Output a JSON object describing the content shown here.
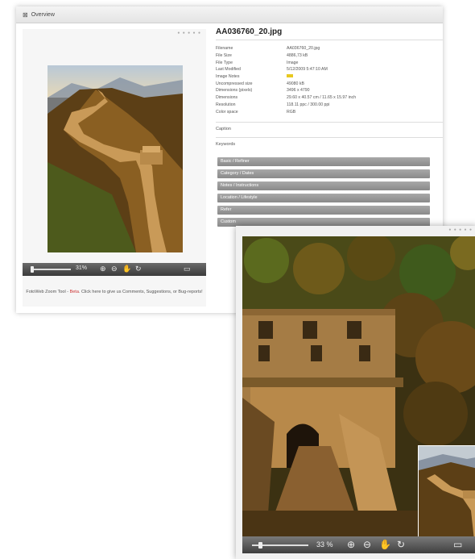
{
  "window": {
    "title": "Overview"
  },
  "viewer": {
    "zoom_level": "31%",
    "feedback_prefix": "FotoWeb Zoom Tool - ",
    "feedback_beta": "Beta",
    "feedback_suffix": ". Click here to give us Comments, Suggestions, or Bug-reports!"
  },
  "file": {
    "name": "AA036760_20.jpg",
    "meta": [
      {
        "key": "Filename",
        "value": "AA036760_20.jpg"
      },
      {
        "key": "File Size",
        "value": "4886,73 kB"
      },
      {
        "key": "File Type",
        "value": "Image"
      },
      {
        "key": "Last Modified",
        "value": "5/12/2009 5:47:10 AM"
      },
      {
        "key": "Image Notes",
        "value": ""
      },
      {
        "key": "Uncompressed size",
        "value": "49080 kB"
      },
      {
        "key": "Dimensions (pixels)",
        "value": "3496 x 4790"
      },
      {
        "key": "Dimensions",
        "value": "29.60 x 40.57 cm / 11.65 x 15.97 inch"
      },
      {
        "key": "Resolution",
        "value": "118.11 ppc / 300.00 ppi"
      },
      {
        "key": "Color space",
        "value": "RGB"
      }
    ]
  },
  "sections": {
    "captions": "Caption",
    "keywords": "Keywords"
  },
  "accordion": [
    "Basic / Refiner",
    "Category / Dates",
    "Notes / Instructions",
    "Location / Lifestyle",
    "Refer",
    "Custom"
  ],
  "zoom_window": {
    "zoom_level": "33 %"
  },
  "colors": {
    "toolbar": "#4a4a4a",
    "accordion": "#9a9a9a",
    "beta": "#cc3333"
  }
}
